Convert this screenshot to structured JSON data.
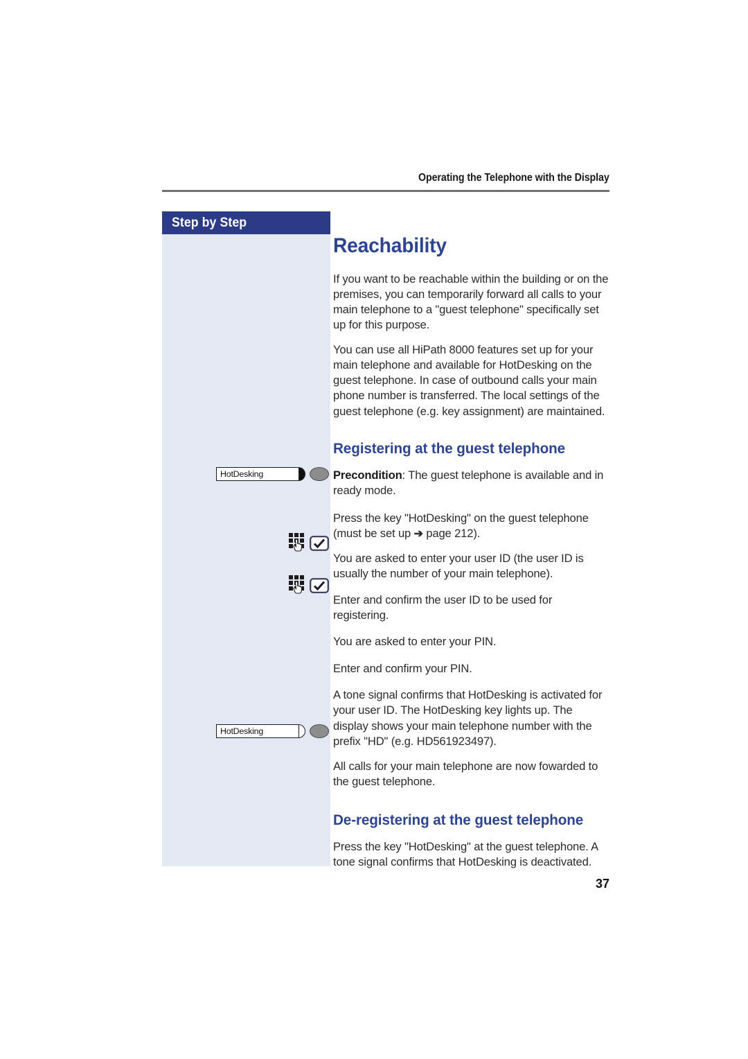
{
  "header": {
    "running_title": "Operating the Telephone with the Display"
  },
  "sidebar": {
    "title": "Step by Step"
  },
  "page": {
    "number": "37"
  },
  "content": {
    "title": "Reachability",
    "intro_paragraphs": [
      "If you want to be reachable within the building or on the premises, you can temporarily forward all calls to your main telephone to a \"guest telephone\" specifically set up for this purpose.",
      "You can use all HiPath 8000 features set up for your main telephone and available for HotDesking on the guest telephone. In case of outbound calls your main phone number is transferred. The local settings of the guest telephone (e.g. key assignment) are maintained."
    ],
    "section_registering": {
      "heading": "Registering at the guest telephone",
      "precondition_label": "Precondition",
      "precondition_text": ": The guest telephone is available and in ready mode.",
      "step_press_key_part1": "Press the key \"HotDesking\" on the guest telephone (must be set up ",
      "step_press_key_arrow": "➔",
      "step_press_key_part2": " page 212).",
      "step_asked_user_id": "You are asked to enter your user ID (the user ID is usually the number of your main telephone).",
      "step_enter_user_id": "Enter and confirm the user ID to be used for registering.",
      "step_asked_pin": "You are asked to enter your PIN.",
      "step_enter_pin": "Enter and confirm your PIN.",
      "step_tone_signal": "A tone signal confirms that HotDesking is activated for your user ID. The HotDesking key lights up. The display shows your main telephone number with the prefix \"HD\" (e.g. HD561923497).",
      "step_all_calls": "All calls for your main telephone are now fowarded to the guest telephone."
    },
    "section_deregistering": {
      "heading": "De-registering at the guest telephone",
      "step_press_key": "Press the key \"HotDesking\" at the guest telephone. A tone signal confirms that HotDesking is deactivated."
    }
  },
  "margin_icons": {
    "hotdesking_key_1": {
      "label": "HotDesking",
      "cap_state": "filled",
      "led_color": "#8d8d8d"
    },
    "hotdesking_key_2": {
      "label": "HotDesking",
      "cap_state": "hollow",
      "led_color": "#8d8d8d"
    },
    "keypad_icon_name": "keypad-with-hand-icon",
    "confirm_icon_name": "confirm-checkmark-icon"
  },
  "colors": {
    "sidebar_bg": "#e4e8f3",
    "sidebar_title_bar": "#2b3b85",
    "heading_blue": "#2d4491",
    "rule_gray": "#6f6f6f"
  }
}
